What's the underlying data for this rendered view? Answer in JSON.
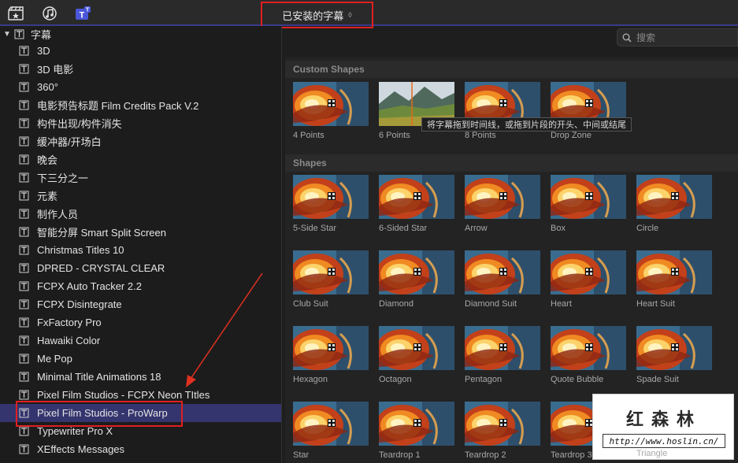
{
  "toolbar": {
    "icons": [
      "clapper-star-icon",
      "music-notes-icon",
      "titles-icon"
    ],
    "library_title": "已安装的字幕",
    "library_chevron": "⌃⌄"
  },
  "sidebar": {
    "root_label": "字幕",
    "items": [
      {
        "label": "3D"
      },
      {
        "label": "3D 电影"
      },
      {
        "label": "360°"
      },
      {
        "label": "电影预告标题 Film Credits Pack V.2"
      },
      {
        "label": "构件出现/构件消失"
      },
      {
        "label": "缓冲器/开场白"
      },
      {
        "label": "晚会"
      },
      {
        "label": "下三分之一"
      },
      {
        "label": "元素"
      },
      {
        "label": "制作人员"
      },
      {
        "label": "智能分屏 Smart Split Screen"
      },
      {
        "label": "Christmas Titles 10"
      },
      {
        "label": "DPRED - CRYSTAL CLEAR"
      },
      {
        "label": "FCPX Auto Tracker 2.2"
      },
      {
        "label": "FCPX Disintegrate"
      },
      {
        "label": "FxFactory Pro"
      },
      {
        "label": "Hawaiki Color"
      },
      {
        "label": "Me Pop"
      },
      {
        "label": "Minimal Title Animations 18"
      },
      {
        "label": "Pixel Film Studios - FCPX Neon TItles"
      },
      {
        "label": "Pixel Film Studios - ProWarp",
        "selected": true
      },
      {
        "label": "Typewriter Pro X"
      },
      {
        "label": "XEffects Messages"
      }
    ]
  },
  "search": {
    "placeholder": "搜索"
  },
  "browser": {
    "sections": [
      {
        "title": "Custom Shapes",
        "clips": [
          {
            "caption": "4 Points",
            "thumb": "swirl"
          },
          {
            "caption": "6 Points",
            "thumb": "landscape"
          },
          {
            "caption": "8 Points",
            "thumb": "swirl"
          },
          {
            "caption": "Drop Zone",
            "thumb": "swirl"
          }
        ]
      },
      {
        "title": "Shapes",
        "clips": [
          {
            "caption": "5-Side Star"
          },
          {
            "caption": "6-Sided Star"
          },
          {
            "caption": "Arrow"
          },
          {
            "caption": "Box"
          },
          {
            "caption": "Circle"
          },
          {
            "caption": "Club Suit"
          },
          {
            "caption": "Diamond"
          },
          {
            "caption": "Diamond Suit"
          },
          {
            "caption": "Heart"
          },
          {
            "caption": "Heart Suit"
          },
          {
            "caption": "Hexagon"
          },
          {
            "caption": "Octagon"
          },
          {
            "caption": "Pentagon"
          },
          {
            "caption": "Quote Bubble"
          },
          {
            "caption": "Spade Suit"
          },
          {
            "caption": "Star"
          },
          {
            "caption": "Teardrop 1"
          },
          {
            "caption": "Teardrop 2"
          },
          {
            "caption": "Teardrop 3"
          },
          {
            "caption": "Triangle"
          }
        ]
      }
    ],
    "tooltip": "将字幕拖到时间线，或拖到片段的开头、中间或结尾"
  },
  "watermark": {
    "title": "红森林",
    "url": "http://www.hoslin.cn/"
  },
  "colors": {
    "selection": "#34356e",
    "highlight_box": "#e02020",
    "arrow": "#e03020"
  }
}
